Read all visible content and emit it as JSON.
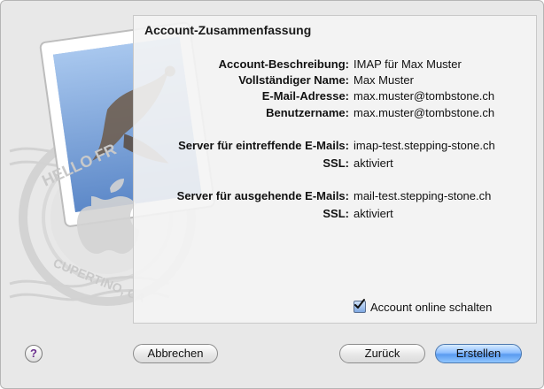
{
  "summary": {
    "title": "Account-Zusammenfassung",
    "rows": [
      {
        "label": "Account-Beschreibung:",
        "value": "IMAP für Max Muster"
      },
      {
        "label": "Vollständiger Name:",
        "value": "Max Muster"
      },
      {
        "label": "E-Mail-Adresse:",
        "value": "max.muster@tombstone.ch"
      },
      {
        "label": "Benutzername:",
        "value": "max.muster@tombstone.ch"
      },
      {
        "label": "Server für eintreffende E-Mails:",
        "value": "imap-test.stepping-stone.ch"
      },
      {
        "label": "SSL:",
        "value": "aktiviert"
      },
      {
        "label": "Server für ausgehende E-Mails:",
        "value": "mail-test.stepping-stone.ch"
      },
      {
        "label": "SSL:",
        "value": "aktiviert"
      }
    ]
  },
  "options": {
    "account_online_label": "Account online schalten",
    "account_online_checked": true
  },
  "buttons": {
    "help": "?",
    "cancel": "Abbrechen",
    "back": "Zurück",
    "create": "Erstellen"
  },
  "stamp": {
    "text_top": "HELLO FR",
    "text_bottom": "CUPERTINO, CA"
  }
}
